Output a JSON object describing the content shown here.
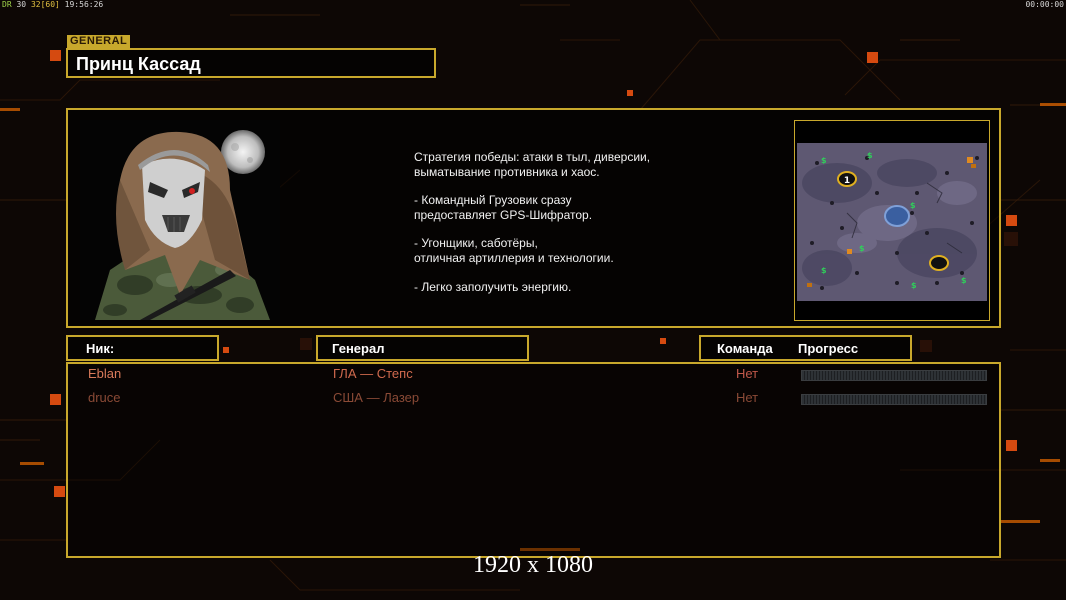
{
  "hud": {
    "fps_label": "DR",
    "fps_a": "30",
    "fps_b": "32",
    "fps_c": "[60]",
    "clock": "19:56:26",
    "timer": "00:00:00"
  },
  "general_tag": "GENERAL",
  "general_name": "Принц Кассад",
  "description": [
    "Стратегия победы: атаки в тыл, диверсии,\n выматывание противника и хаос.",
    "- Командный Грузовик сразу\nпредоставляет GPS-Шифратор.",
    "- Угонщики, саботёры,\nотличная артиллерия и технологии.",
    "- Легко заполучить энергию."
  ],
  "columns": {
    "nick": "Ник:",
    "general": "Генерал",
    "team": "Команда",
    "progress": "Прогресс"
  },
  "players": [
    {
      "nick": "Eblan",
      "general": "ГЛА — Степс",
      "team": "Нет",
      "progress": 0
    },
    {
      "nick": "druce",
      "general": "США — Лазер",
      "team": "Нет",
      "progress": 0
    }
  ],
  "map": {
    "start_marker": "1"
  },
  "resolution_text": "1920 x 1080",
  "colors": {
    "frame": "#c8a82c",
    "accent_orange": "#ff6a00"
  }
}
